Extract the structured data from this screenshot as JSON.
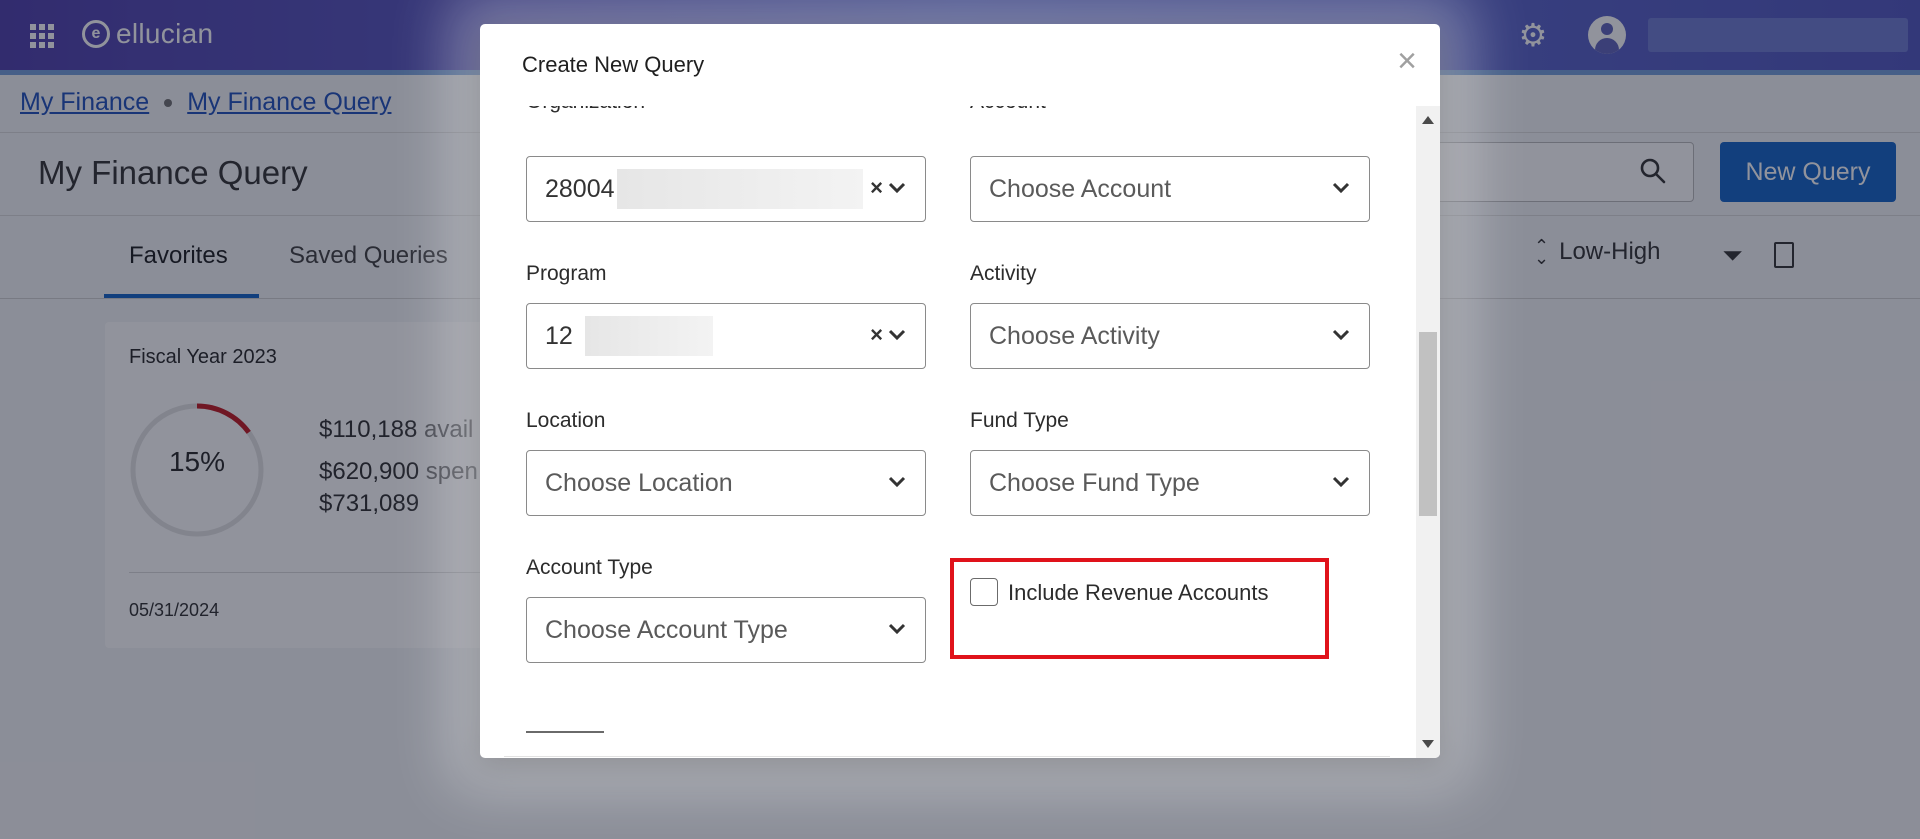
{
  "app": {
    "brand": "ellucian",
    "breadcrumb": [
      "My Finance",
      "My Finance Query"
    ],
    "page_title": "My Finance Query",
    "new_query_label": "New Query",
    "tabs": [
      "Favorites",
      "Saved Queries"
    ],
    "sort_label": "Low-High",
    "card": {
      "title": "Fiscal Year 2023",
      "percent_label": "15%",
      "percent_value": 0.15,
      "available": "$110,188",
      "available_suffix": "avail",
      "spent": "$620,900",
      "spent_suffix": "spen",
      "total": "$731,089",
      "date": "05/31/2024"
    }
  },
  "modal": {
    "title": "Create New Query",
    "close_glyph": "×",
    "clipped_labels": {
      "left": "Organization",
      "right": "Account"
    },
    "organization": {
      "value": "28004"
    },
    "account": {
      "placeholder": "Choose Account"
    },
    "program": {
      "label": "Program",
      "value": "12"
    },
    "activity": {
      "label": "Activity",
      "placeholder": "Choose Activity"
    },
    "location": {
      "label": "Location",
      "placeholder": "Choose Location"
    },
    "fund_type": {
      "label": "Fund Type",
      "placeholder": "Choose Fund Type"
    },
    "account_type": {
      "label": "Account Type",
      "placeholder": "Choose Account Type"
    },
    "include_revenue": {
      "label": "Include Revenue Accounts",
      "checked": false
    },
    "clear_glyph": "×"
  },
  "colors": {
    "header": "#4a3aa8",
    "primary_button": "#0c5ec4",
    "highlight_border": "#e0121a",
    "progress_arc": "#c0121a"
  }
}
